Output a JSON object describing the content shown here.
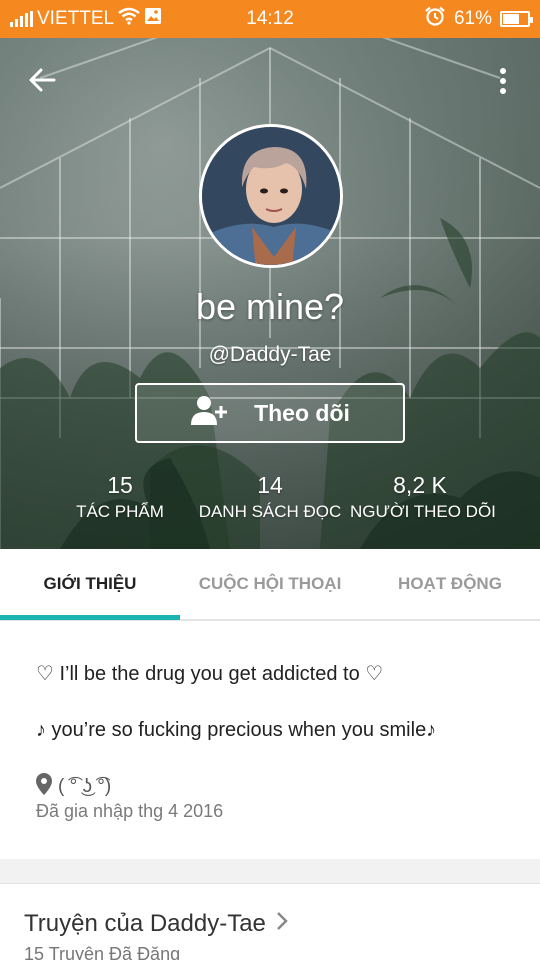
{
  "status_bar": {
    "carrier": "VIETTEL",
    "time": "14:12",
    "battery": "61%",
    "battery_level": 0.61
  },
  "profile": {
    "display_name": "be mine?",
    "username": "@Daddy-Tae",
    "follow_label": "Theo dõi"
  },
  "stats": [
    {
      "value": "15",
      "label": "TÁC PHẨM"
    },
    {
      "value": "14",
      "label": "DANH SÁCH ĐỌC"
    },
    {
      "value": "8,2 K",
      "label": "NGƯỜI THEO DÕI"
    }
  ],
  "tabs": [
    {
      "label": "GIỚI THIỆU",
      "active": true
    },
    {
      "label": "CUỘC HỘI THOẠI",
      "active": false
    },
    {
      "label": "HOẠT ĐỘNG",
      "active": false
    }
  ],
  "about": {
    "bio_lines": [
      "♡ I’ll be the drug you get addicted to ♡",
      "♪ you’re so fucking precious when you smile♪"
    ],
    "location": "( ͡° ͜ʖ ͡°)",
    "joined": "Đã gia nhập thg 4 2016"
  },
  "stories_section": {
    "title": "Truyện của Daddy-Tae",
    "subtitle": "15 Truyện Đã Đăng"
  },
  "colors": {
    "status_bar": "#f5891f",
    "tab_indicator": "#1ab5b0"
  },
  "icons": {
    "back": "arrow-left-icon",
    "more": "more-vertical-icon",
    "follow": "person-add-icon",
    "location": "location-pin-icon",
    "chevron": "chevron-right-icon"
  }
}
